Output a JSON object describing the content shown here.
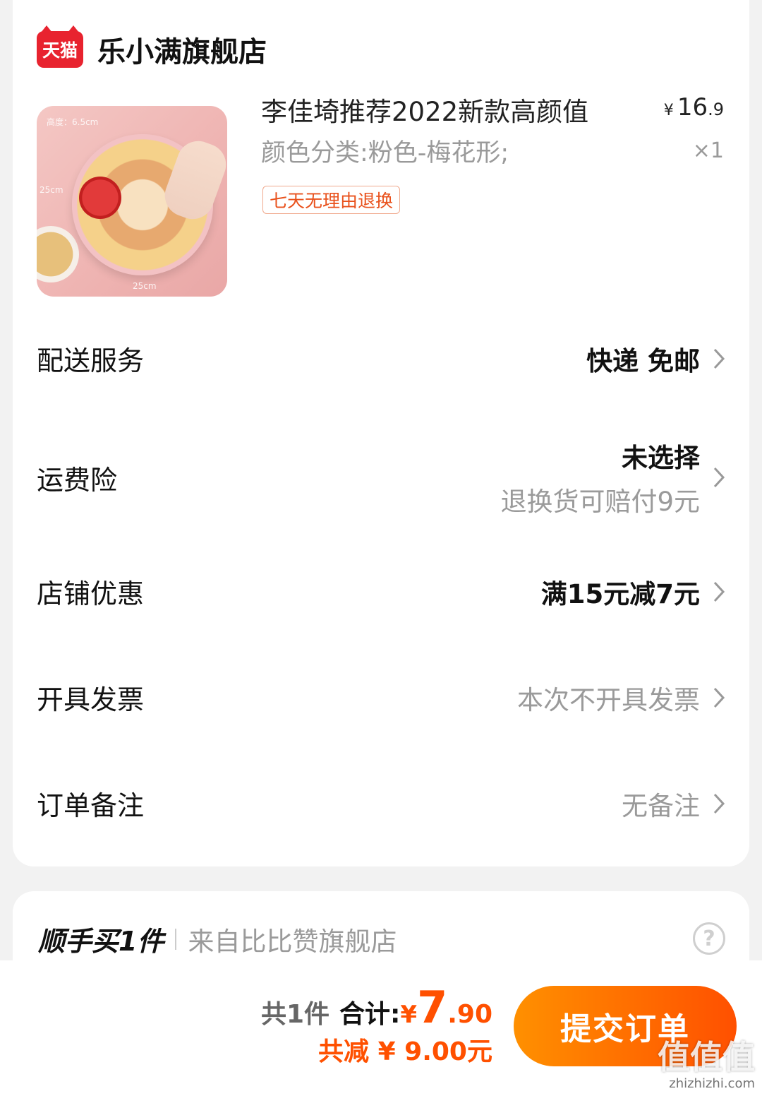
{
  "shop": {
    "logo_text": "天猫",
    "name": "乐小满旗舰店"
  },
  "product": {
    "image_overlay": {
      "height_label": "高度：6.5cm",
      "side_label": "25cm",
      "bottom_label": "25cm"
    },
    "title": "李佳埼推荐2022新款高颜值",
    "spec": "颜色分类:粉色-梅花形;",
    "price": {
      "currency": "¥",
      "integer": "16",
      "decimal": ".9"
    },
    "quantity": "×1",
    "tag": "七天无理由退换"
  },
  "rows": {
    "delivery": {
      "label": "配送服务",
      "value": "快递 免邮"
    },
    "shipping_insurance": {
      "label": "运费险",
      "value": "未选择",
      "sub": "退换货可赔付9元"
    },
    "store_discount": {
      "label": "店铺优惠",
      "value": "满15元减7元"
    },
    "invoice": {
      "label": "开具发票",
      "value": "本次不开具发票"
    },
    "note": {
      "label": "订单备注",
      "value": "无备注"
    }
  },
  "addon": {
    "title": "顺手买1件",
    "source": "来自比比赞旗舰店",
    "help": "?"
  },
  "footer": {
    "count": "共1件",
    "total_label": "合计:",
    "total": {
      "currency": "¥",
      "integer": "7",
      "decimal": ".90"
    },
    "saved": "共减 ¥ 9.00元",
    "submit": "提交订单"
  },
  "watermark": {
    "text": "值值值",
    "url": "zhizhizhi.com"
  },
  "colors": {
    "accent": "#ff5000",
    "tmall_red": "#e8232f",
    "tag_orange": "#e9521d"
  }
}
